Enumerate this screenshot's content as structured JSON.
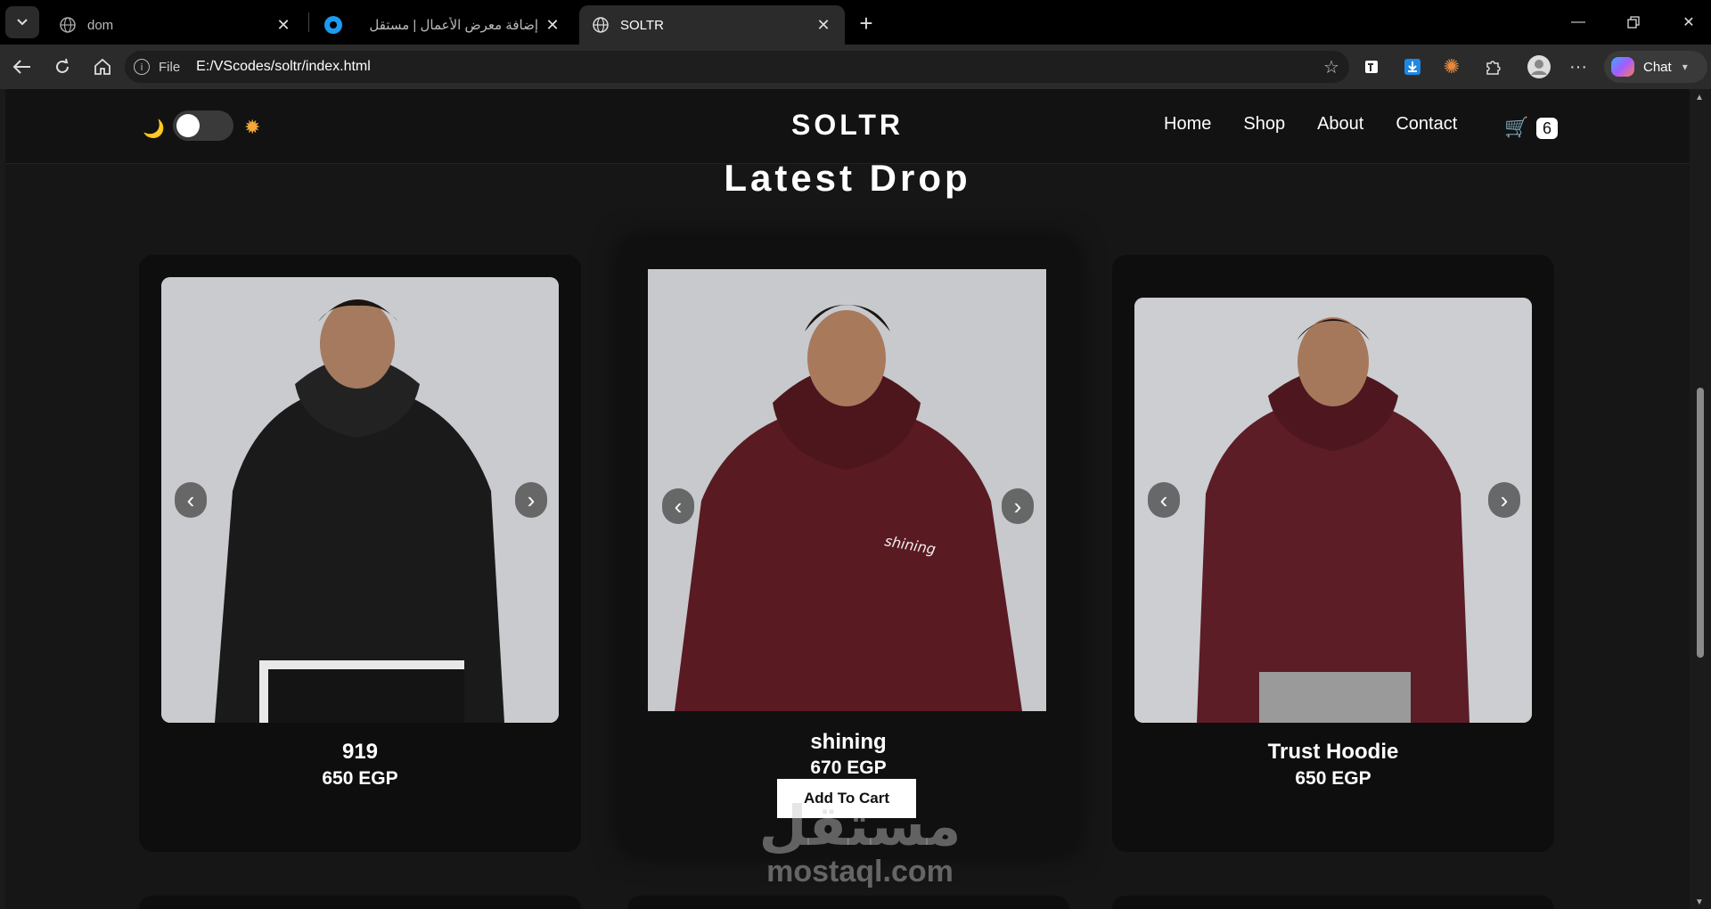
{
  "browser": {
    "tabs": [
      {
        "title": "dom",
        "active": false
      },
      {
        "title": "إضافة معرض الأعمال | مستقل",
        "active": false
      },
      {
        "title": "SOLTR",
        "active": true
      }
    ],
    "address": {
      "scheme": "File",
      "url": "E:/VScodes/soltr/index.html"
    },
    "chat_label": "Chat"
  },
  "site": {
    "brand": "SOLTR",
    "nav": [
      "Home",
      "Shop",
      "About",
      "Contact"
    ],
    "cart_count": "6",
    "theme_toggle": {
      "state": "dark"
    }
  },
  "section": {
    "title": "Latest Drop"
  },
  "products": [
    {
      "name": "919",
      "price": "650 EGP",
      "hoodie_color": "#1a1a1a"
    },
    {
      "name": "shining",
      "price": "670 EGP",
      "hoodie_color": "#5a1a22",
      "button": "Add To Cart"
    },
    {
      "name": "Trust Hoodie",
      "price": "650 EGP",
      "hoodie_color": "#5c1d26"
    }
  ],
  "watermark": {
    "arabic": "مستقل",
    "latin": "mostaql.com"
  }
}
